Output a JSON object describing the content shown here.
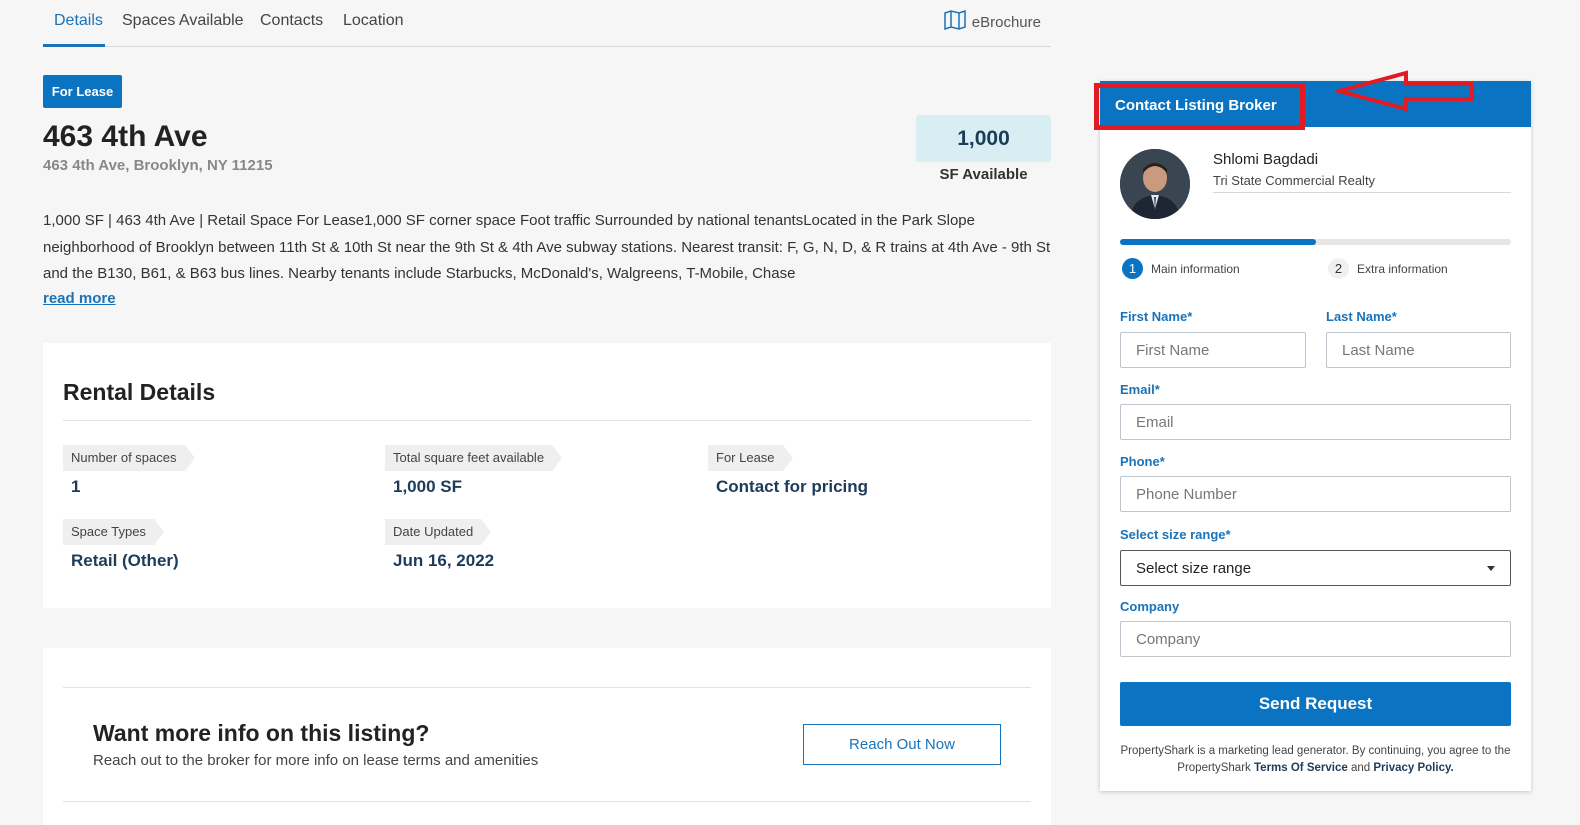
{
  "tabs": [
    {
      "label": "Details"
    },
    {
      "label": "Spaces Available"
    },
    {
      "label": "Contacts"
    },
    {
      "label": "Location"
    }
  ],
  "ebrochure_label": "eBrochure",
  "listing": {
    "badge": "For Lease",
    "title": "463 4th Ave",
    "address": "463 4th Ave, Brooklyn, NY 11215",
    "sf_value": "1,000",
    "sf_label": "SF Available",
    "description": "1,000 SF | 463 4th Ave | Retail Space For Lease1,000 SF corner space Foot traffic Surrounded by national tenantsLocated in the Park Slope neighborhood of Brooklyn between 11th St & 10th St near the 9th St & 4th Ave subway stations. Nearest transit: F, G, N, D, & R trains at 4th Ave - 9th St and the B130, B61, & B63 bus lines. Nearby tenants include Starbucks, McDonald's, Walgreens, T-Mobile, Chase",
    "read_more": "read more"
  },
  "rental": {
    "title": "Rental Details",
    "items": [
      {
        "label": "Number of spaces",
        "value": "1"
      },
      {
        "label": "Total square feet available",
        "value": "1,000 SF"
      },
      {
        "label": "For Lease",
        "value": "Contact for pricing"
      },
      {
        "label": "Space Types",
        "value": "Retail (Other)"
      },
      {
        "label": "Date Updated",
        "value": "Jun 16, 2022"
      }
    ]
  },
  "more_info": {
    "title": "Want more info on this listing?",
    "subtitle": "Reach out to the broker for more info on lease terms and amenities",
    "button": "Reach Out Now"
  },
  "contact_panel": {
    "header": "Contact Listing Broker",
    "broker_name": "Shlomi Bagdadi",
    "broker_company": "Tri State Commercial Realty",
    "progress": 0.5,
    "steps": [
      {
        "num": "1",
        "label": "Main information"
      },
      {
        "num": "2",
        "label": "Extra information"
      }
    ],
    "fields": {
      "first_name_label": "First Name",
      "first_name_placeholder": "First Name",
      "last_name_label": "Last Name",
      "last_name_placeholder": "Last Name",
      "email_label": "Email",
      "email_placeholder": "Email",
      "phone_label": "Phone",
      "phone_placeholder": "Phone Number",
      "size_label": "Select size range",
      "size_value": "Select size range",
      "company_label": "Company",
      "company_placeholder": "Company"
    },
    "required_mark": "*",
    "send_button": "Send Request",
    "disclaimer_text": "PropertyShark is a marketing lead generator. By continuing, you agree to the PropertyShark",
    "terms_link": "Terms Of Service",
    "and_text": "and",
    "privacy_link": "Privacy Policy."
  },
  "colors": {
    "accent": "#0a74c2",
    "highlight": "#e21b23"
  }
}
